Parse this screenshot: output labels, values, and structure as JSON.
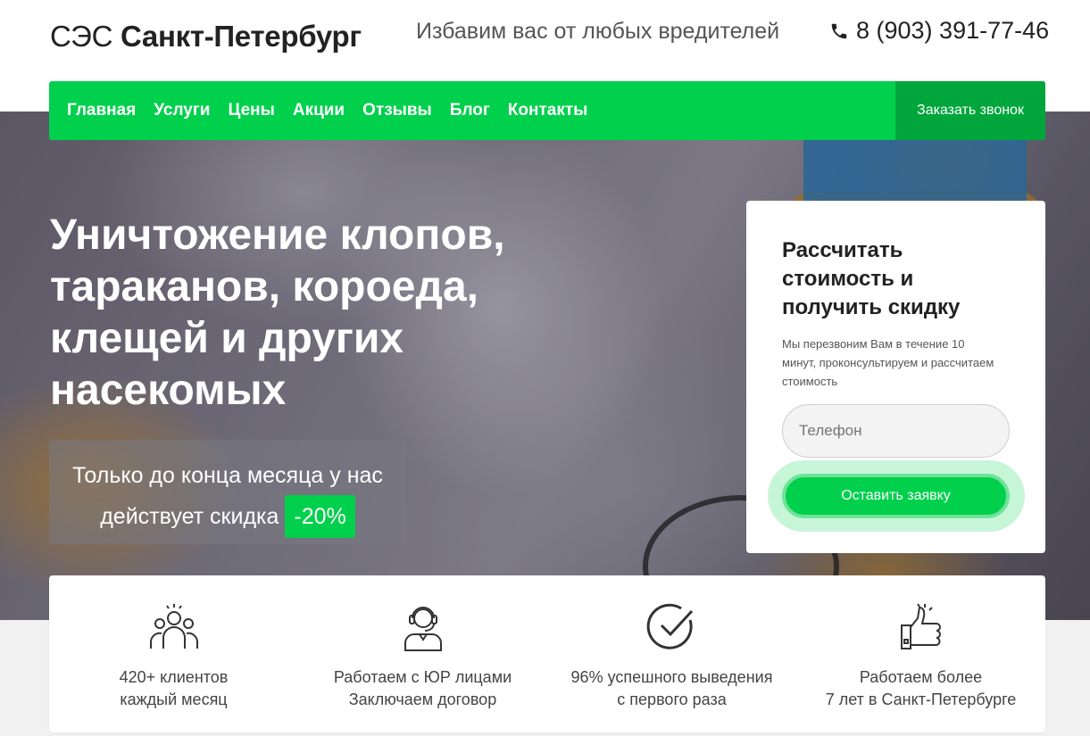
{
  "header": {
    "logo_prefix": "СЭС",
    "logo_city": "Санкт-Петербург",
    "tagline": "Избавим вас от любых вредителей",
    "phone": "8 (903) 391-77-46"
  },
  "nav": {
    "items": [
      "Главная",
      "Услуги",
      "Цены",
      "Акции",
      "Отзывы",
      "Блог",
      "Контакты"
    ],
    "cta": "Заказать звонок"
  },
  "hero": {
    "headline": "Уничтожение клопов, тараканов, короеда, клещей и других насекомых",
    "promo_text": "Только до конца месяца у нас действует скидка",
    "promo_badge": "-20%"
  },
  "form": {
    "title": "Рассчитать стоимость и получить скидку",
    "description": "Мы перезвоним Вам в течение 10 минут, проконсультируем и рассчитаем стоимость",
    "phone_placeholder": "Телефон",
    "submit": "Оставить заявку"
  },
  "features": [
    {
      "icon": "team-icon",
      "line1": "420+ клиентов",
      "line2": "каждый месяц"
    },
    {
      "icon": "operator-icon",
      "line1": "Работаем с ЮР лицами",
      "line2": "Заключаем договор"
    },
    {
      "icon": "checkmark-icon",
      "line1": "96% успешного выведения",
      "line2": "с первого раза"
    },
    {
      "icon": "thumbs-up-icon",
      "line1": "Работаем более",
      "line2": "7 лет в Санкт-Петербурге"
    }
  ],
  "colors": {
    "accent": "#00d04c",
    "accent_dark": "#00a63c"
  }
}
